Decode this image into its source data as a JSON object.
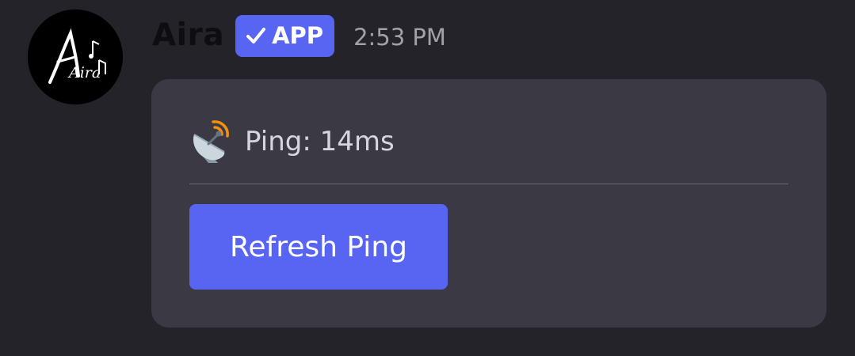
{
  "message": {
    "author": "Aira",
    "badge": "APP",
    "badge_icon": "check-icon",
    "timestamp": "2:53 PM"
  },
  "avatar": {
    "text": "Aira",
    "icon": "aira-logo"
  },
  "embed": {
    "ping_icon": "satellite-dish-icon",
    "ping_text": "Ping: 14ms",
    "button_label": "Refresh Ping"
  },
  "colors": {
    "background": "#232329",
    "card": "#3b3a44",
    "accent": "#5865f2",
    "timestamp": "#a0a1a9",
    "ping_text": "#d6d7dc"
  }
}
